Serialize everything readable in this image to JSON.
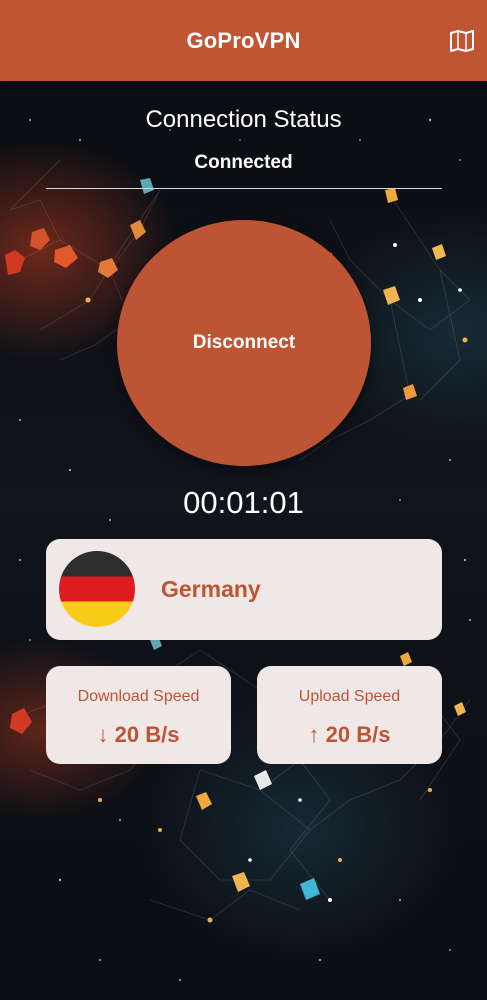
{
  "app": {
    "title": "GoProVPN",
    "accent_color": "#bf5532",
    "map_icon": "map-icon"
  },
  "connection": {
    "status_title": "Connection Status",
    "status_value": "Connected",
    "button_label": "Disconnect",
    "timer": "00:01:01"
  },
  "server": {
    "country": "Germany",
    "flag_icon": "germany-flag-icon",
    "flag_colors": [
      "#2e2e2e",
      "#dd1d1d",
      "#f7cd1a"
    ]
  },
  "speeds": {
    "download": {
      "label": "Download Speed",
      "value": "↓ 20 B/s"
    },
    "upload": {
      "label": "Upload Speed",
      "value": "↑ 20 B/s"
    }
  },
  "colors": {
    "card_bg": "#f0e7e7",
    "text_accent": "#bd5433",
    "background": "#0b0d12"
  }
}
